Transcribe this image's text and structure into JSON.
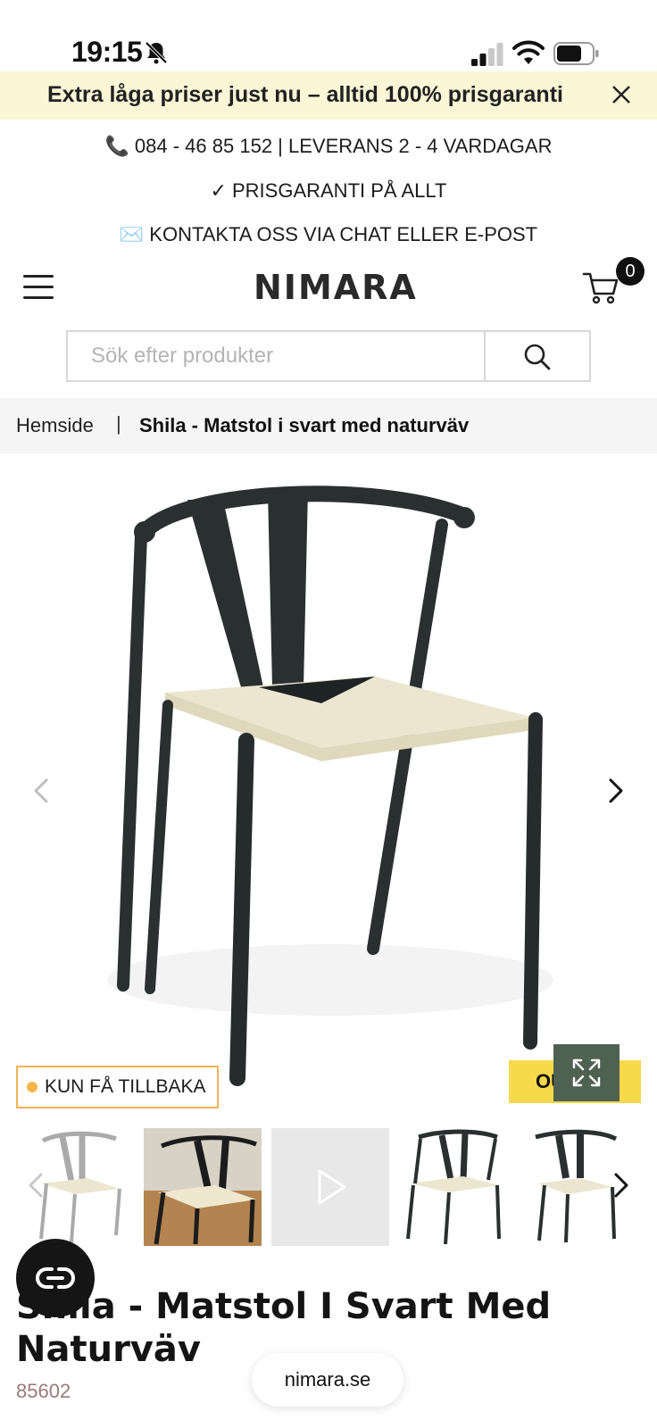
{
  "status_bar": {
    "time": "19:15"
  },
  "promo": {
    "text": "Extra låga priser just nu – alltid 100% prisgaranti"
  },
  "usps": [
    {
      "icon": "phone-icon",
      "glyph": "📞",
      "text": "084 - 46 85 152 | LEVERANS 2 - 4 VARDAGAR"
    },
    {
      "icon": "check-icon",
      "glyph": "✓",
      "text": "PRISGARANTI PÅ ALLT"
    },
    {
      "icon": "envelope-icon",
      "glyph": "✉️",
      "text": "KONTAKTA OSS VIA CHAT ELLER E-POST"
    }
  ],
  "header": {
    "logo": "NIMARA",
    "cart_count": "0"
  },
  "search": {
    "placeholder": "Sök efter produkter",
    "value": ""
  },
  "breadcrumb": {
    "home": "Hemside",
    "separator": "|",
    "current": "Shila - Matstol i svart med naturväv"
  },
  "gallery": {
    "stock_badge": "KUN FÅ TILLBAKA",
    "yellow_badge": "OU",
    "colors": {
      "accent_yellow": "#f7d94a",
      "expand_green": "#4f6150",
      "stock_orange": "#f2b25a"
    }
  },
  "product": {
    "title": "Shila - Matstol I Svart Med Naturväv",
    "sku": "85602"
  },
  "browser": {
    "url": "nimara.se"
  }
}
